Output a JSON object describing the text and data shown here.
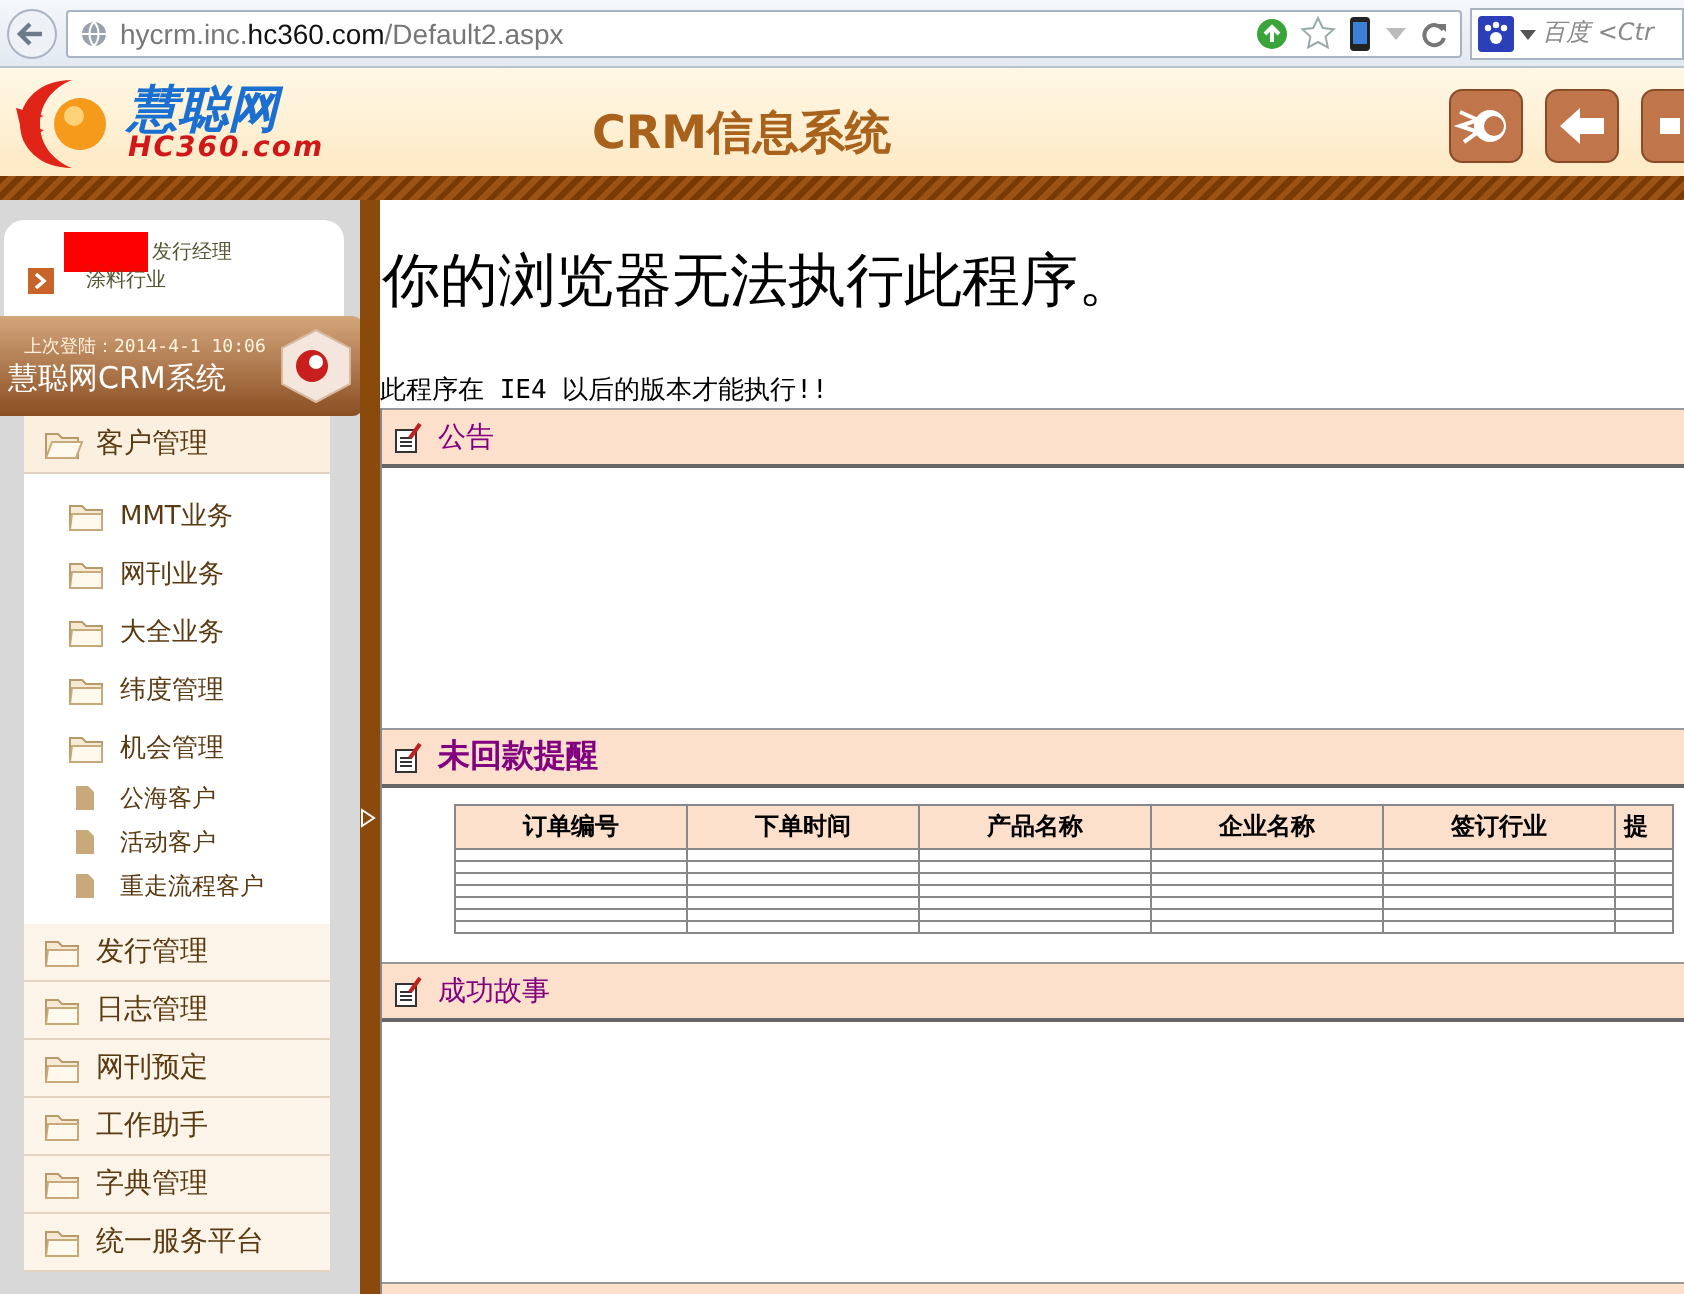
{
  "browser": {
    "url": {
      "prefix": "hycrm.inc.",
      "domain": "hc360.com",
      "path": "/Default2.aspx"
    },
    "search_placeholder": "百度 <Ctr"
  },
  "header": {
    "logo_name": "慧聪网",
    "logo_domain": "HC360.com",
    "title": "CRM信息系统"
  },
  "user": {
    "role": "发行经理",
    "industry": "涂料行业"
  },
  "banner": {
    "last_login": "上次登陆：2014-4-1 10:06",
    "system_name": "慧聪网CRM系统"
  },
  "menu": [
    {
      "label": "客户管理",
      "expanded": true,
      "children": [
        {
          "label": "MMT业务",
          "kind": "folder"
        },
        {
          "label": "网刊业务",
          "kind": "folder"
        },
        {
          "label": "大全业务",
          "kind": "folder"
        },
        {
          "label": "纬度管理",
          "kind": "folder"
        },
        {
          "label": "机会管理",
          "kind": "folder"
        },
        {
          "label": "公海客户",
          "kind": "page"
        },
        {
          "label": "活动客户",
          "kind": "page"
        },
        {
          "label": "重走流程客户",
          "kind": "page"
        }
      ]
    },
    {
      "label": "发行管理",
      "expanded": false
    },
    {
      "label": "日志管理",
      "expanded": false
    },
    {
      "label": "网刊预定",
      "expanded": false
    },
    {
      "label": "工作助手",
      "expanded": false
    },
    {
      "label": "字典管理",
      "expanded": false
    },
    {
      "label": "统一服务平台",
      "expanded": false
    }
  ],
  "content": {
    "heading": "你的浏览器无法执行此程序。",
    "notice": "此程序在 IE4 以后的版本才能执行!!",
    "sections": [
      {
        "title": "公告",
        "kind": "text"
      },
      {
        "title": "未回款提醒",
        "kind": "table",
        "columns": [
          "订单编号",
          "下单时间",
          "产品名称",
          "企业名称",
          "签订行业",
          "提"
        ]
      },
      {
        "title": "成功故事",
        "kind": "text"
      },
      {
        "kind": "text"
      }
    ]
  }
}
